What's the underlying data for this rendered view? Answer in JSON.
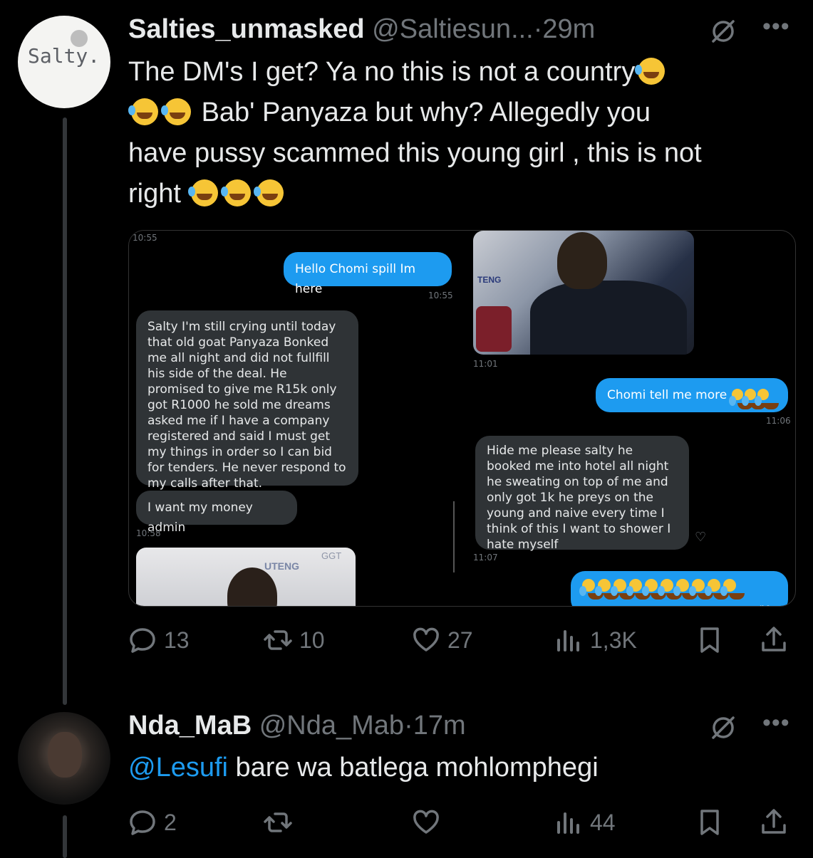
{
  "tweet1": {
    "display_name": "Salties_unmasked",
    "handle": "@Saltiesun...",
    "separator": "·",
    "time": "29m",
    "avatar_text": "Salty.",
    "text_line1": "The DM's I get? Ya no this is not a country",
    "text_line2": "Bab' Panyaza but why? Allegedly you",
    "text_line3": "have pussy scammed this young girl , this is not",
    "text_line4": "right",
    "media": {
      "left_status_time": "10:55",
      "msg1": "Hello Chomi spill Im here",
      "msg1_time": "10:55",
      "msg2": "Salty I'm still crying until today that old goat Panyaza Bonked me all night and did not fullfill his side of the deal. He promised to give me R15k only got R1000 he sold me dreams asked me if I have a company registered and said I must get my things in order so I can bid for tenders. He never respond to my calls after that.",
      "msg3": "I want my money admin",
      "msg3_time": "10:58",
      "photo1_label": "UTENG",
      "photo1_tag": "GGT",
      "right_photo_time": "11:01",
      "right_photo_label": "TENG",
      "msg4": "Chomi tell me more",
      "msg4_time": "11:06",
      "msg5": "Hide me please salty he booked me into hotel all night he sweating on top of me and only got 1k he preys on the young and naive every time I think of this I want to shower I hate myself",
      "msg5_time": "11:07",
      "msg6_tail": "no"
    },
    "actions": {
      "replies": "13",
      "retweets": "10",
      "likes": "27",
      "views": "1,3K"
    }
  },
  "tweet2": {
    "display_name": "Nda_MaB",
    "handle": "@Nda_Mab",
    "separator": "·",
    "time": "17m",
    "mention": "@Lesufi",
    "text": " bare wa batlega mohlomphegi",
    "actions": {
      "replies": "2",
      "retweets": "",
      "likes": "",
      "views": "44"
    }
  },
  "icons": [
    "grok-icon",
    "more-icon",
    "reply-icon",
    "retweet-icon",
    "like-icon",
    "views-icon",
    "bookmark-icon",
    "share-icon"
  ],
  "colors": {
    "background": "#000000",
    "text": "#e7e9ea",
    "muted": "#71767b",
    "accent": "#1d9bf0"
  }
}
